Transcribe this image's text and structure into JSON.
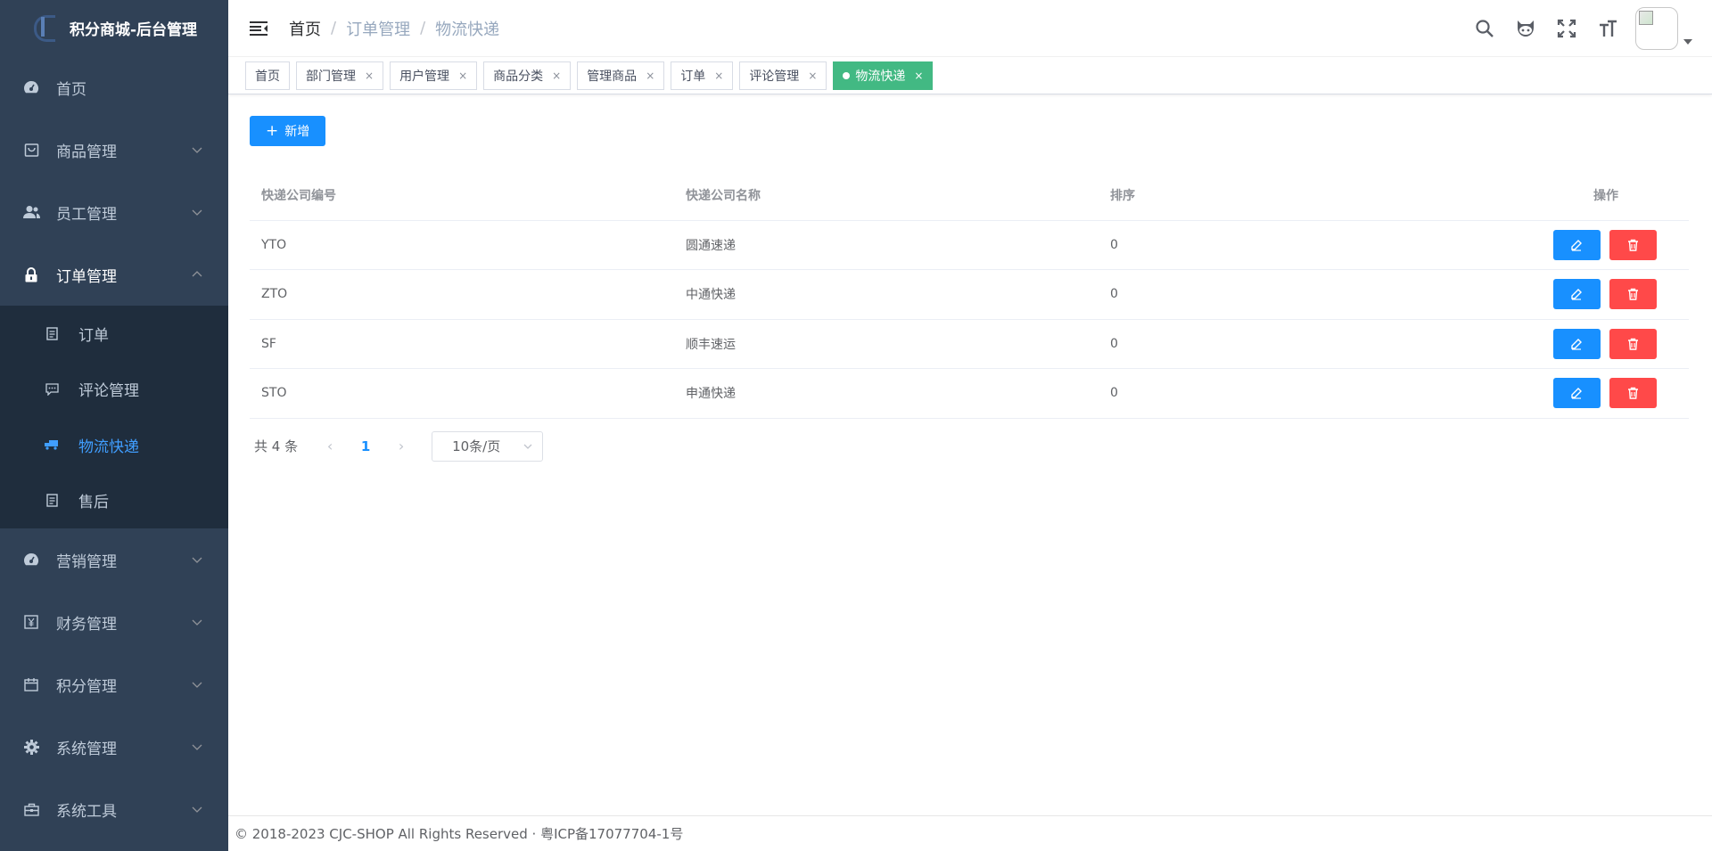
{
  "app": {
    "title": "积分商城-后台管理"
  },
  "sidebar": {
    "items": [
      {
        "label": "首页",
        "icon": "dashboard-icon"
      },
      {
        "label": "商品管理",
        "icon": "goods-icon"
      },
      {
        "label": "员工管理",
        "icon": "people-icon"
      },
      {
        "label": "订单管理",
        "icon": "lock-icon"
      },
      {
        "label": "营销管理",
        "icon": "marketing-icon"
      },
      {
        "label": "财务管理",
        "icon": "finance-icon"
      },
      {
        "label": "积分管理",
        "icon": "points-icon"
      },
      {
        "label": "系统管理",
        "icon": "gear-icon"
      },
      {
        "label": "系统工具",
        "icon": "toolbox-icon"
      }
    ],
    "sub_items": [
      {
        "label": "订单",
        "icon": "document-icon"
      },
      {
        "label": "评论管理",
        "icon": "comment-icon"
      },
      {
        "label": "物流快递",
        "icon": "truck-icon"
      },
      {
        "label": "售后",
        "icon": "document-icon"
      }
    ]
  },
  "breadcrumb": [
    "首页",
    "订单管理",
    "物流快递"
  ],
  "tags": [
    {
      "label": "首页",
      "closable": false
    },
    {
      "label": "部门管理",
      "closable": true
    },
    {
      "label": "用户管理",
      "closable": true
    },
    {
      "label": "商品分类",
      "closable": true
    },
    {
      "label": "管理商品",
      "closable": true
    },
    {
      "label": "订单",
      "closable": true
    },
    {
      "label": "评论管理",
      "closable": true
    },
    {
      "label": "物流快递",
      "closable": true,
      "active": true
    }
  ],
  "tag_close": "×",
  "toolbar": {
    "add_label": "新增",
    "add_plus": "+"
  },
  "table": {
    "headers": [
      "快递公司编号",
      "快递公司名称",
      "排序",
      "操作"
    ],
    "rows": [
      {
        "code": "YTO",
        "name": "圆通速递",
        "sort": "0"
      },
      {
        "code": "ZTO",
        "name": "中通快递",
        "sort": "0"
      },
      {
        "code": "SF",
        "name": "顺丰速运",
        "sort": "0"
      },
      {
        "code": "STO",
        "name": "申通快递",
        "sort": "0"
      }
    ]
  },
  "pagination": {
    "total": "共 4 条",
    "current_page": "1",
    "page_size": "10条/页"
  },
  "footer": {
    "text": "© 2018-2023 CJC-SHOP All Rights Reserved · 粤ICP备17077704-1号"
  },
  "colors": {
    "sidebar_bg": "#304156",
    "submenu_bg": "#1f2d3d",
    "primary": "#1890ff",
    "danger": "#ff4949",
    "active_tag": "#42b983"
  }
}
